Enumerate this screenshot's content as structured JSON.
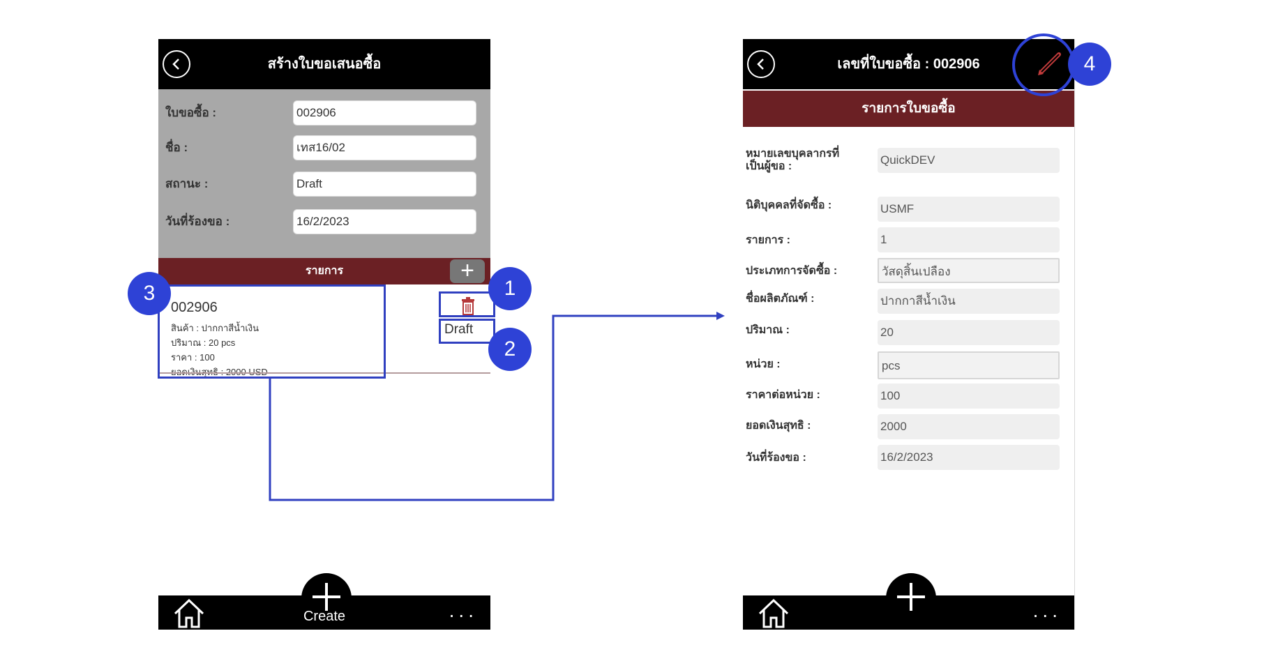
{
  "left_screen": {
    "title": "สร้างใบขอเสนอซื้อ",
    "form": [
      {
        "label": "ใบขอซื้อ :",
        "value": "002906"
      },
      {
        "label": "ชื่อ :",
        "value": "เทส16/02"
      },
      {
        "label": "สถานะ :",
        "value": "Draft"
      },
      {
        "label": "วันที่ร้องขอ :",
        "value": "16/2/2023"
      }
    ],
    "section_title": "รายการ",
    "add_symbol": "+",
    "item": {
      "id": "002906",
      "product": "สินค้า : ปากกาสีน้ำเงิน",
      "quantity": "ปริมาณ : 20 pcs",
      "price": "ราคา : 100",
      "net_total": "ยอดเงินสุทธิ : 2000 USD",
      "status": "Draft"
    },
    "bottom": {
      "create_label": "Create",
      "more": "..."
    }
  },
  "right_screen": {
    "title": "เลขที่ใบขอซื้อ : 002906",
    "section_title": "รายการใบขอซื้อ",
    "fields": [
      {
        "label": "หมายเลขบุคลากรที่เป็นผู้ขอ :",
        "value": "QuickDEV"
      },
      {
        "label": "นิติบุคคลที่จัดซื้อ :",
        "value": "USMF"
      },
      {
        "label": "รายการ :",
        "value": "1"
      },
      {
        "label": "ประเภทการจัดซื้อ :",
        "value": "วัสดุสิ้นเปลือง"
      },
      {
        "label": "ชื่อผลิตภัณฑ์ :",
        "value": "ปากกาสีน้ำเงิน"
      },
      {
        "label": "ปริมาณ :",
        "value": "20"
      },
      {
        "label": "หน่วย :",
        "value": "pcs"
      },
      {
        "label": "ราคาต่อหน่วย :",
        "value": "100"
      },
      {
        "label": "ยอดเงินสุทธิ :",
        "value": "2000"
      },
      {
        "label": "วันที่ร้องขอ :",
        "value": "16/2/2023"
      }
    ],
    "bottom": {
      "more": "..."
    }
  },
  "annotations": [
    "1",
    "2",
    "3",
    "4"
  ],
  "colors": {
    "topbar": "#000000",
    "section_bar": "#6b2024",
    "form_bg": "#a8a8a8",
    "annotation": "#2e42d6",
    "trash": "#b5383a"
  }
}
